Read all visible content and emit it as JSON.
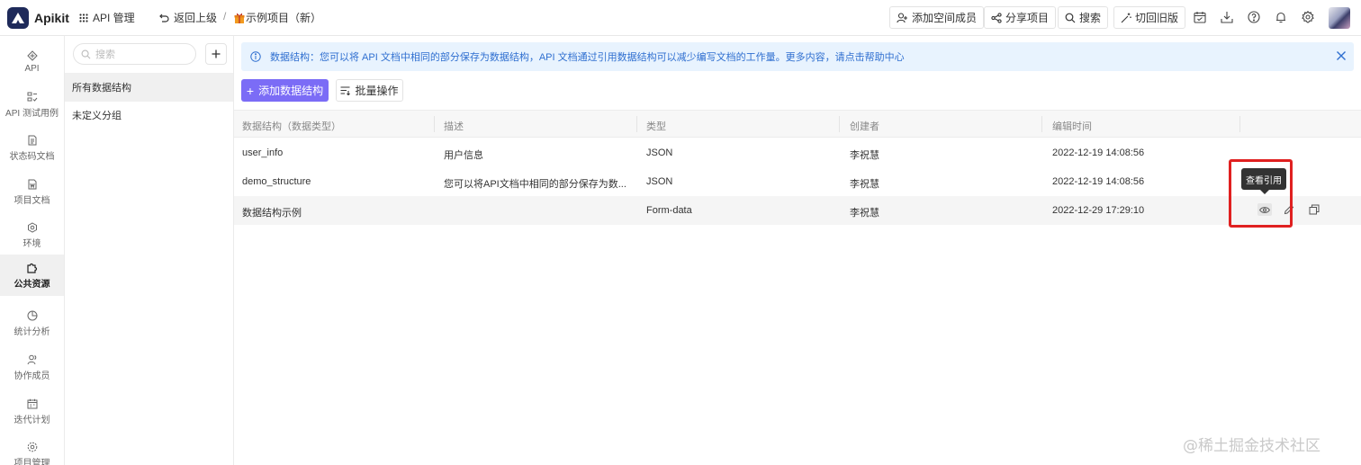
{
  "app": {
    "name": "Apikit"
  },
  "topbar": {
    "api_manage": "API 管理",
    "back": "返回上级",
    "separator": "/",
    "project": "示例项目（新）",
    "add_member": "添加空间成员",
    "share": "分享项目",
    "search": "搜索",
    "switch_old": "切回旧版"
  },
  "sidebar": {
    "items": [
      {
        "label": "API",
        "icon": "api-icon"
      },
      {
        "label": "API 测试用例",
        "icon": "test-case-icon"
      },
      {
        "label": "状态码文档",
        "icon": "status-doc-icon"
      },
      {
        "label": "项目文档",
        "icon": "project-doc-icon"
      },
      {
        "label": "环境",
        "icon": "environment-icon"
      },
      {
        "label": "公共资源",
        "icon": "puzzle-icon",
        "active": true
      },
      {
        "label": "统计分析",
        "icon": "pie-chart-icon"
      },
      {
        "label": "协作成员",
        "icon": "members-icon"
      },
      {
        "label": "迭代计划",
        "icon": "calendar-icon"
      },
      {
        "label": "项目管理",
        "icon": "settings-icon"
      }
    ]
  },
  "groups": {
    "search_placeholder": "搜索",
    "items": [
      "所有数据结构",
      "未定义分组"
    ]
  },
  "notice": {
    "text": "数据结构：您可以将 API 文档中相同的部分保存为数据结构，API 文档通过引用数据结构可以减少编写文档的工作量。更多内容，请点击帮助中心"
  },
  "actions": {
    "add": "添加数据结构",
    "batch": "批量操作"
  },
  "table": {
    "columns": [
      "数据结构（数据类型）",
      "描述",
      "类型",
      "创建者",
      "编辑时间"
    ],
    "rows": [
      {
        "name": "user_info",
        "desc": "用户信息",
        "type": "JSON",
        "creator": "李祝慧",
        "time": "2022-12-19 14:08:56"
      },
      {
        "name": "demo_structure",
        "desc": "您可以将API文档中相同的部分保存为数...",
        "type": "JSON",
        "creator": "李祝慧",
        "time": "2022-12-19 14:08:56"
      },
      {
        "name": "数据结构示例",
        "desc": "",
        "type": "Form-data",
        "creator": "李祝慧",
        "time": "2022-12-29 17:29:10"
      }
    ]
  },
  "tooltip": "查看引用",
  "watermark": "@稀土掘金技术社区",
  "colors": {
    "primary": "#7b6cf6",
    "notice_bg": "#e8f3fe",
    "notice_text": "#2f6fd0",
    "highlight": "#e02020",
    "logo": "#1e2a5a"
  }
}
